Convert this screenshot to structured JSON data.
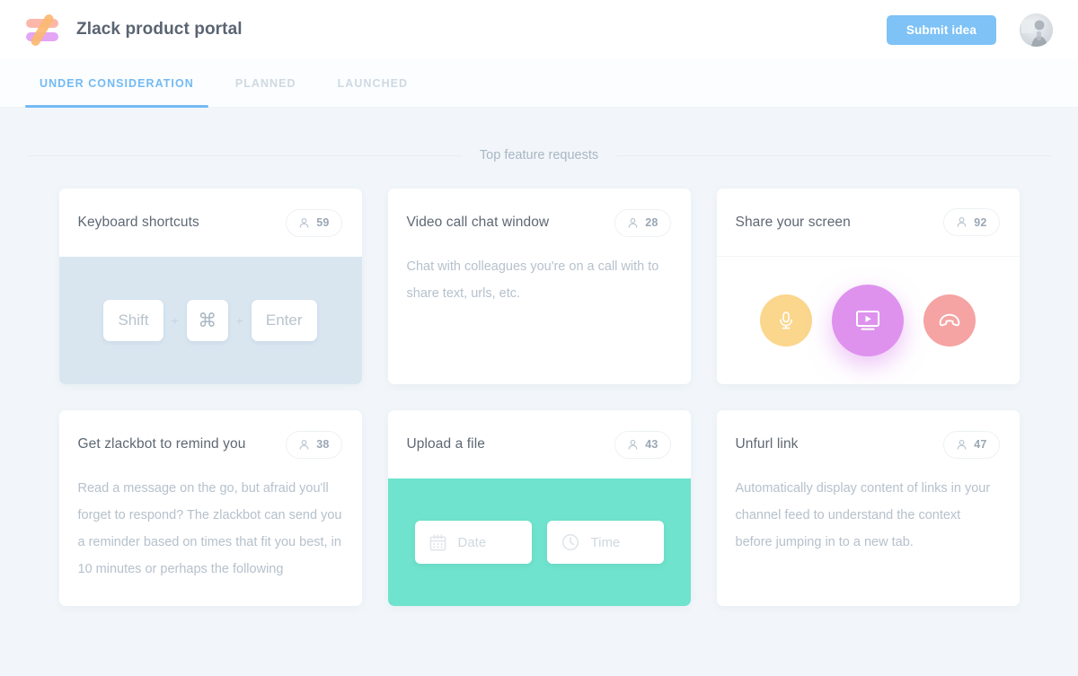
{
  "header": {
    "brand_title": "Zlack product portal",
    "logo_name": "zlack-logo",
    "submit_label": "Submit idea",
    "avatar_name": "user-avatar"
  },
  "tabs": [
    {
      "label": "UNDER CONSIDERATION",
      "active": true
    },
    {
      "label": "PLANNED",
      "active": false
    },
    {
      "label": "LAUNCHED",
      "active": false
    }
  ],
  "section": {
    "title": "Top feature requests"
  },
  "cards": [
    {
      "title": "Keyboard shortcuts",
      "votes": "59",
      "body_type": "keyboard",
      "keys": [
        "Shift",
        "⌘",
        "Enter"
      ],
      "separator": "+",
      "panel_color": "#d9e6f0"
    },
    {
      "title": "Video call chat window",
      "votes": "28",
      "body_type": "text",
      "description": "Chat with colleagues you're on a call with to share text, urls, etc."
    },
    {
      "title": "Share your screen",
      "votes": "92",
      "body_type": "call",
      "buttons": [
        {
          "name": "microphone-button",
          "color": "#fbd68d"
        },
        {
          "name": "share-screen-button",
          "color": "#de92ee"
        },
        {
          "name": "hang-up-button",
          "color": "#f5a3a3"
        }
      ]
    },
    {
      "title": "Get zlackbot to remind you",
      "votes": "38",
      "body_type": "text",
      "description": "Read a message on the go, but afraid you'll forget to respond? The zlackbot can send you a reminder based on times that fit you best, in 10 minutes or perhaps the following"
    },
    {
      "title": "Upload a file",
      "votes": "43",
      "body_type": "datetime",
      "date_placeholder": "Date",
      "time_placeholder": "Time",
      "panel_color": "#6fe3cd"
    },
    {
      "title": "Unfurl link",
      "votes": "47",
      "body_type": "text",
      "description": "Automatically display content of links in your channel feed to understand the context before jumping in to a new tab."
    }
  ],
  "colors": {
    "page_background": "#f2f6fa",
    "accent_blue": "#7ec2f6",
    "tab_active": "#74baf4",
    "card_background": "#ffffff",
    "text_muted": "#b6c1cc"
  }
}
